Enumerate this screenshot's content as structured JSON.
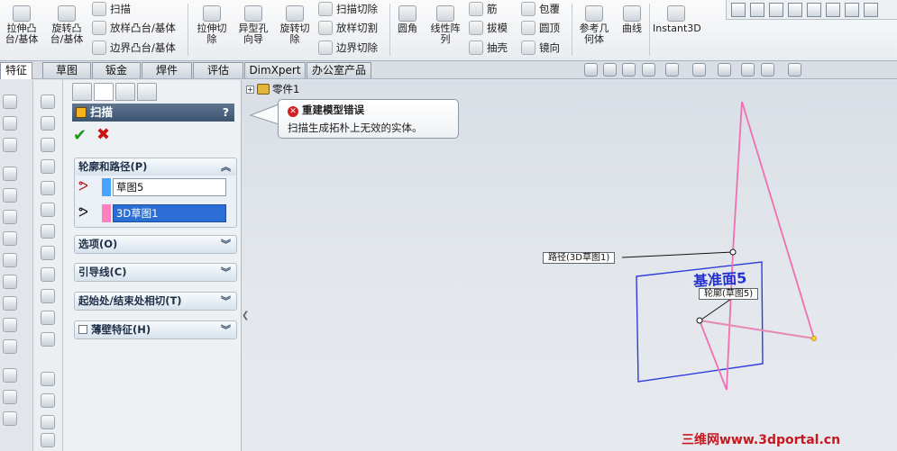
{
  "ribbon": {
    "buttons": [
      {
        "label": "拉伸凸\n台/基体"
      },
      {
        "label": "旋转凸\n台/基体"
      },
      {
        "label": "拉伸切\n除"
      },
      {
        "label": "异型孔\n向导"
      },
      {
        "label": "旋转切\n除"
      },
      {
        "label": "圆角"
      },
      {
        "label": "线性阵\n列"
      },
      {
        "label": "参考几\n何体"
      },
      {
        "label": "曲线"
      },
      {
        "label": "Instant3D"
      }
    ],
    "small": {
      "sweep": "扫描",
      "loft": "放样凸台/基体",
      "boundary": "边界凸台/基体",
      "sweep_cut": "扫描切除",
      "loft_cut": "放样切割",
      "boundary_cut": "边界切除",
      "rib": "筋",
      "draft": "拔模",
      "shell": "抽壳",
      "wrap": "包覆",
      "dome": "圆顶",
      "mirror": "镜向"
    }
  },
  "tabs": [
    "特征",
    "草图",
    "钣金",
    "焊件",
    "评估",
    "DimXpert",
    "办公室产品"
  ],
  "property_manager": {
    "title": "扫描",
    "help": "?",
    "ok_icon": "check-icon",
    "cancel_icon": "x-icon",
    "profile_path": {
      "header": "轮廓和路径(P)",
      "profile_value": "草图5",
      "profile_color": "#4aa3ff",
      "path_value": "3D草图1",
      "path_color": "#ff7fbf"
    },
    "groups": [
      {
        "label": "选项(O)"
      },
      {
        "label": "引导线(C)"
      },
      {
        "label": "起始处/结束处相切(T)"
      },
      {
        "label": "薄壁特征(H)"
      }
    ]
  },
  "graphics": {
    "tree_root": "零件1",
    "error": {
      "title": "重建模型错误",
      "body": "扫描生成拓朴上无效的实体。"
    },
    "callouts": {
      "path": "路径(3D草图1)",
      "profile": "轮廓(草图5)"
    },
    "plane_label": "基准面5",
    "watermark": "三维网www.3dportal.cn"
  }
}
